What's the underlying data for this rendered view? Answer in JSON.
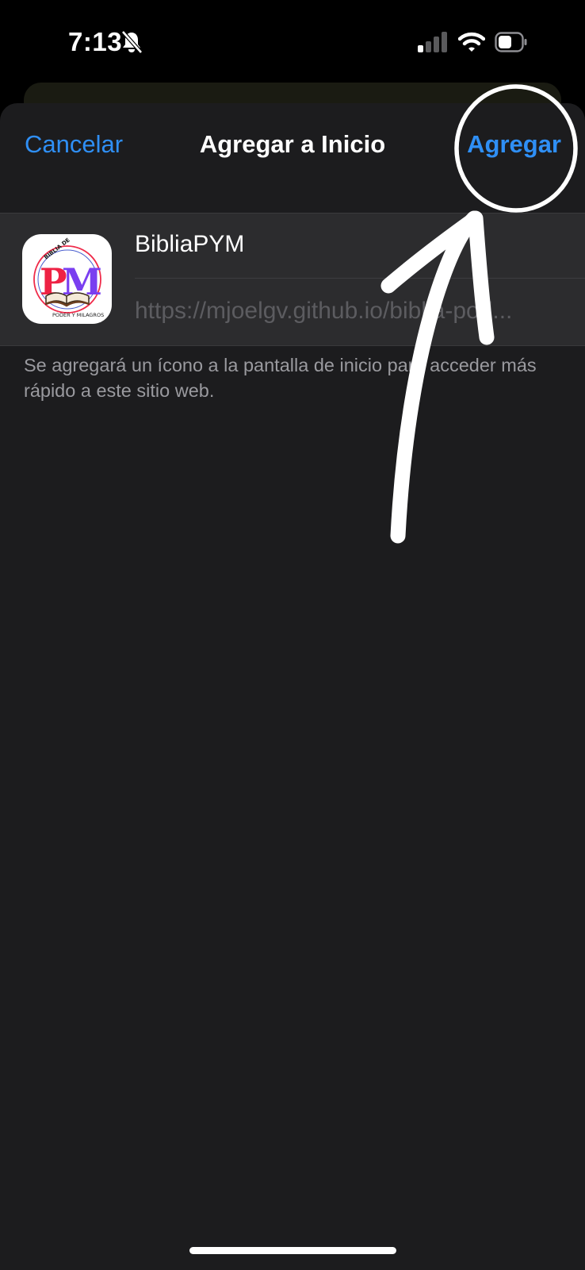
{
  "status_bar": {
    "time": "7:13",
    "icons": [
      "bell-slash-icon",
      "cellular-signal-icon",
      "wifi-icon",
      "battery-icon"
    ]
  },
  "nav": {
    "cancel_label": "Cancelar",
    "title": "Agregar a Inicio",
    "add_label": "Agregar"
  },
  "card": {
    "app_name": "BibliaPYM",
    "url": "https://mjoelgv.github.io/biblia-pod...",
    "icon": {
      "monogram_left": "P",
      "monogram_right": "M",
      "ring_top": "BIBLIA DE",
      "ring_bottom": "PODER Y MILAGROS"
    }
  },
  "footnote": "Se agregará un ícono a la pantalla de inicio para acceder más rápido a este sitio web.",
  "colors": {
    "accent": "#2f8ff5",
    "sheet_background": "#1c1c1e",
    "card_background": "#2c2c2e",
    "footnote_text": "#9a9a9f",
    "annotation": "#ffffff"
  },
  "annotation": {
    "kind": "hand-drawn circle and arrow pointing to the Agregar button"
  }
}
